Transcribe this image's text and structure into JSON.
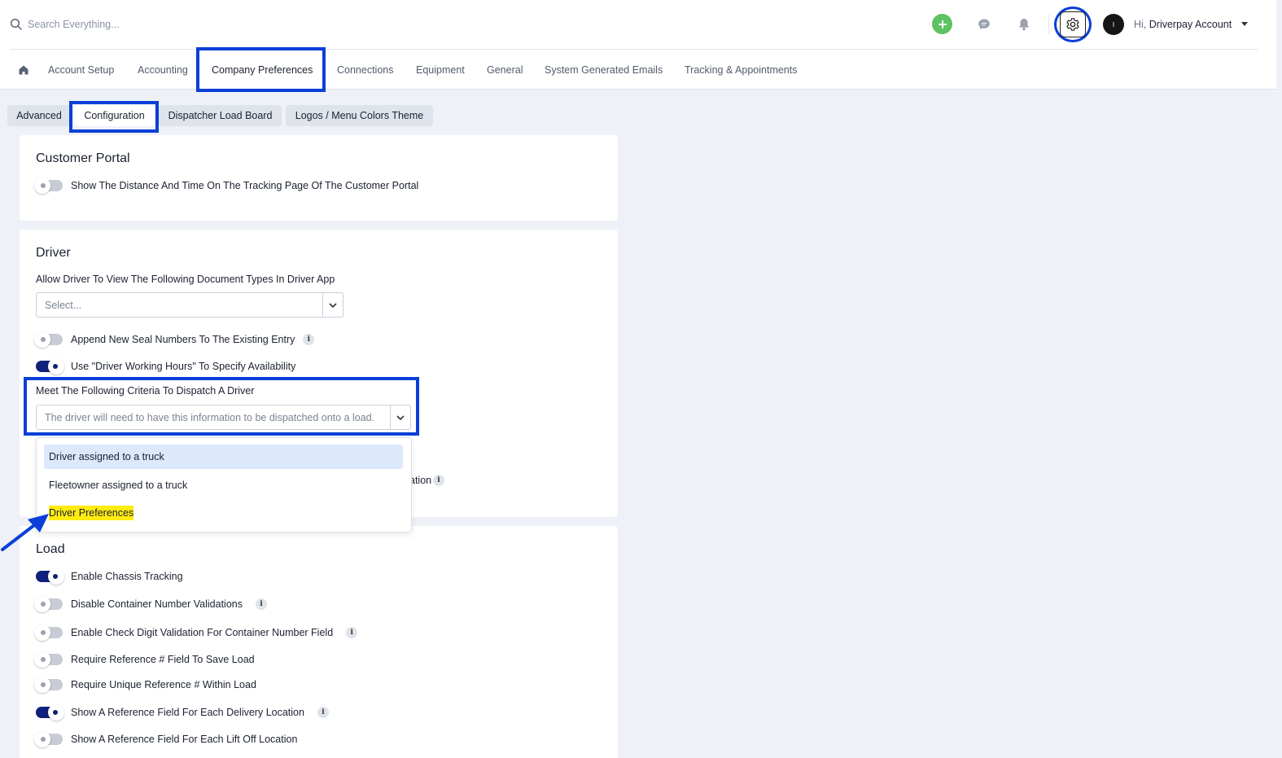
{
  "header": {
    "search_placeholder": "Search Everything...",
    "greeting_prefix": "Hi,",
    "account_name": "Driverpay Account"
  },
  "nav": {
    "tabs": [
      "Account Setup",
      "Accounting",
      "Company Preferences",
      "Connections",
      "Equipment",
      "General",
      "System Generated Emails",
      "Tracking & Appointments"
    ],
    "active": "Company Preferences"
  },
  "subtabs": {
    "items": [
      "Advanced",
      "Configuration",
      "Dispatcher Load Board",
      "Logos / Menu Colors Theme"
    ],
    "active": "Configuration"
  },
  "customer_portal": {
    "title": "Customer Portal",
    "show_distance_label": "Show The Distance And Time On The Tracking Page Of The Customer Portal",
    "show_distance_on": false
  },
  "driver": {
    "title": "Driver",
    "doc_types_label": "Allow Driver To View The Following Document Types In Driver App",
    "doc_types_placeholder": "Select...",
    "append_seal_label": "Append New Seal Numbers To The Existing Entry",
    "append_seal_on": false,
    "working_hours_label": "Use \"Driver Working Hours\" To Specify Availability",
    "working_hours_on": true,
    "criteria_label": "Meet The Following Criteria To Dispatch A Driver",
    "criteria_placeholder": "The driver will need to have this information to be dispatched onto a load.",
    "criteria_options": [
      "Driver assigned to a truck",
      "Fleetowner assigned to a truck",
      "Driver Preferences"
    ],
    "partially_hidden_text": "ation"
  },
  "load": {
    "title": "Load",
    "enable_chassis_label": "Enable Chassis Tracking",
    "disable_container_label": "Disable Container Number Validations",
    "check_digit_label": "Enable Check Digit Validation For Container Number Field",
    "require_ref_label": "Require Reference # Field To Save Load",
    "unique_ref_label": "Require Unique Reference # Within Load",
    "delivery_ref_label": "Show A Reference Field For Each Delivery Location",
    "liftoff_ref_label": "Show A Reference Field For Each Lift Off Location"
  },
  "colors": {
    "highlight_blue": "#0b3fd8",
    "toggle_on": "#11207a",
    "add_green": "#5cc262",
    "text_highlight": "#ffeb0f"
  }
}
